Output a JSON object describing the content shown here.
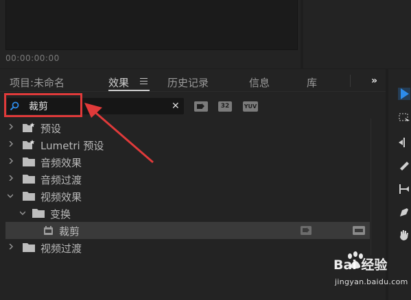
{
  "monitor": {
    "timecode": "00:00:00:00"
  },
  "tabs": [
    {
      "label": "项目:未命名",
      "active": false
    },
    {
      "label": "效果",
      "active": true
    },
    {
      "label": "历史记录",
      "active": false
    },
    {
      "label": "信息",
      "active": false
    },
    {
      "label": "库",
      "active": false
    }
  ],
  "overflow_label": "»",
  "search": {
    "value": "裁剪",
    "clear_label": "✕"
  },
  "filter_buttons": [
    "32",
    "YUV"
  ],
  "tree": [
    {
      "label": "预设",
      "level": 0,
      "expanded": false,
      "type": "preset-folder"
    },
    {
      "label": "Lumetri 预设",
      "level": 0,
      "expanded": false,
      "type": "preset-folder"
    },
    {
      "label": "音频效果",
      "level": 0,
      "expanded": false,
      "type": "folder"
    },
    {
      "label": "音频过渡",
      "level": 0,
      "expanded": false,
      "type": "folder"
    },
    {
      "label": "视频效果",
      "level": 0,
      "expanded": true,
      "type": "folder"
    },
    {
      "label": "变换",
      "level": 1,
      "expanded": true,
      "type": "folder"
    },
    {
      "label": "裁剪",
      "level": 2,
      "expanded": false,
      "type": "effect",
      "selected": true
    },
    {
      "label": "视频过渡",
      "level": 0,
      "expanded": false,
      "type": "folder"
    }
  ],
  "colors": {
    "highlight": "#e03a3a",
    "accent": "#2d8ceb",
    "panel": "#232323"
  },
  "watermark": {
    "brand": "Bai 经验",
    "url": "jingyan.baidu.com"
  }
}
